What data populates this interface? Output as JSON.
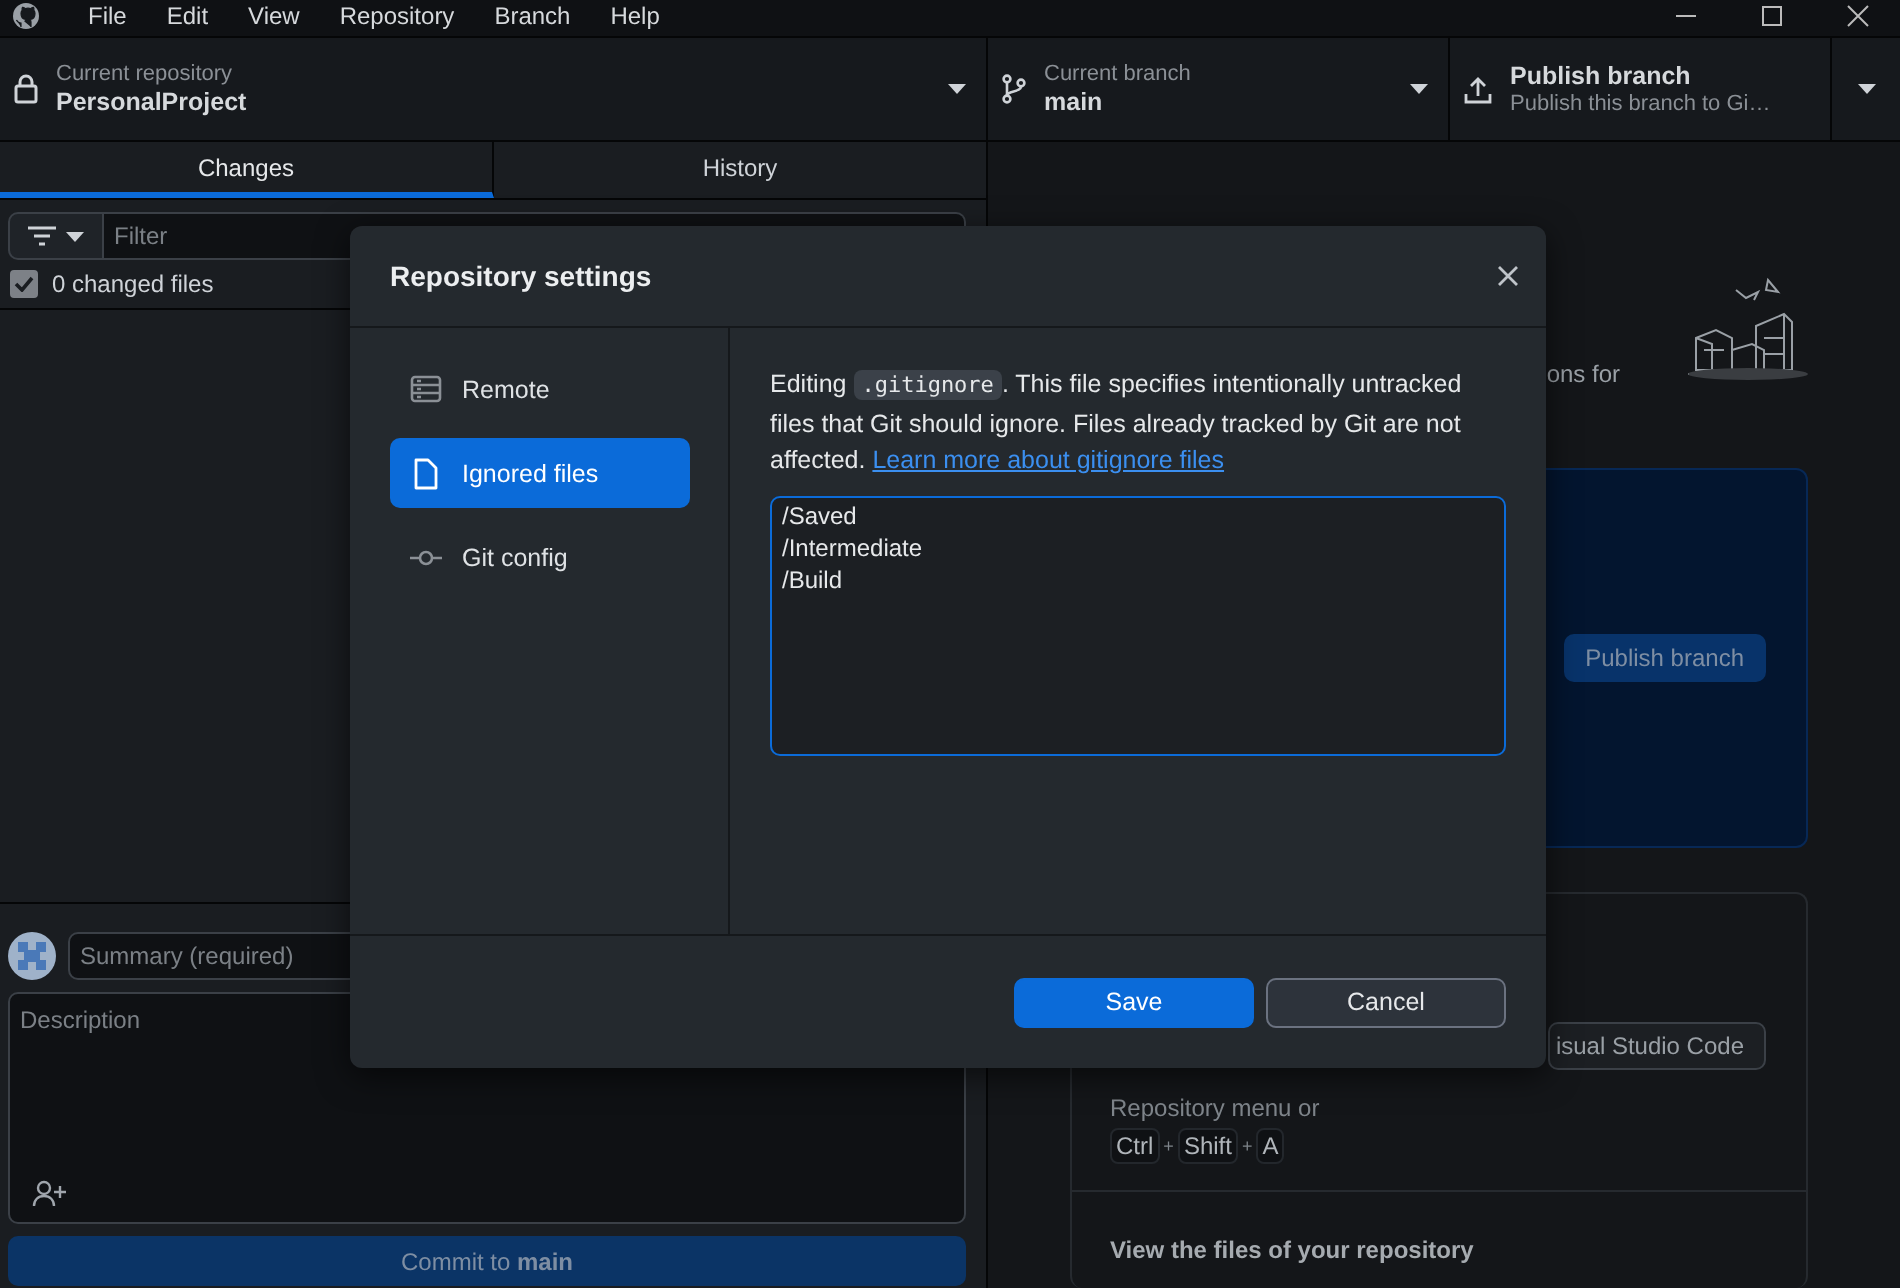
{
  "menu": [
    "File",
    "Edit",
    "View",
    "Repository",
    "Branch",
    "Help"
  ],
  "toolbar": {
    "repository": {
      "label": "Current repository",
      "name": "PersonalProject"
    },
    "branch": {
      "label": "Current branch",
      "name": "main"
    },
    "publish": {
      "title": "Publish branch",
      "subtitle": "Publish this branch to Gi…"
    }
  },
  "tabs": [
    {
      "label": "Changes",
      "selected": true
    },
    {
      "label": "History",
      "selected": false
    }
  ],
  "filter": {
    "placeholder": "Filter"
  },
  "changes": {
    "label": "0 changed files",
    "checked": true
  },
  "commit": {
    "summary_placeholder": "Summary (required)",
    "description_placeholder": "Description",
    "button": "Commit to **main**",
    "disabled": true
  },
  "right_pane": {
    "intro_fragment": "ons for",
    "publish_button": "Publish branch",
    "editor_button": "isual Studio Code",
    "hint": "Repository menu or",
    "shortcut": [
      {
        "kind": "key",
        "text": "Ctrl"
      },
      {
        "kind": "plus",
        "text": "+"
      },
      {
        "kind": "key",
        "text": "Shift"
      },
      {
        "kind": "plus",
        "text": "+"
      },
      {
        "kind": "key",
        "text": "A"
      }
    ],
    "files_title": "View the files of your repository"
  },
  "dialog": {
    "title": "Repository settings",
    "nav": [
      {
        "label": "Remote",
        "kind": "server",
        "selected": false
      },
      {
        "label": "Ignored files",
        "kind": "file",
        "selected": true
      },
      {
        "label": "Git config",
        "kind": "commit",
        "selected": false
      }
    ],
    "description": "Editing ",
    "code": ".gitignore",
    "description_rest": ". This file specifies intentionally untracked files that Git should ignore. Files already tracked by Git are not affected. ",
    "link": "Learn more about gitignore files",
    "content": "/Saved\n/Intermediate\n/Build",
    "buttons": [
      {
        "label": "Save",
        "kind": "primary"
      },
      {
        "label": "Cancel",
        "kind": "secondary"
      }
    ]
  }
}
